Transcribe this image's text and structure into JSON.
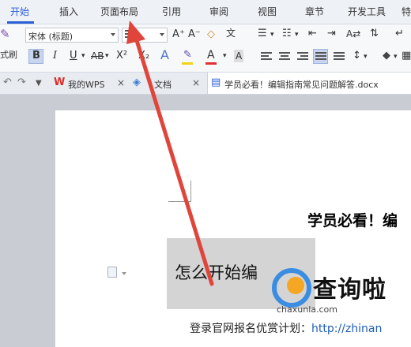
{
  "menu": {
    "tabs": [
      {
        "label": "开始",
        "active": true
      },
      {
        "label": "插入"
      },
      {
        "label": "页面布局"
      },
      {
        "label": "引用"
      },
      {
        "label": "审阅"
      },
      {
        "label": "视图"
      },
      {
        "label": "章节"
      },
      {
        "label": "开发工具"
      },
      {
        "label": "特"
      }
    ]
  },
  "ribbon": {
    "brush_label": "式刷",
    "font_name": "宋体 (标题)",
    "bold": "B",
    "italic": "I",
    "underline": "U",
    "strike": "AB",
    "superscript": "X²",
    "subscript": "X₂",
    "grow_font": "A⁺",
    "shrink_font": "A⁻",
    "text_effect": "A",
    "highlight": "✎",
    "font_color": "A",
    "char_shade": "A",
    "phonetic": "文"
  },
  "doc_tabs": [
    {
      "label": "我的WPS",
      "close": "×"
    },
    {
      "label": "文档",
      "close": "×"
    },
    {
      "label": "学员必看！编辑指南常见问题解答.docx",
      "close": "×",
      "active": true
    }
  ],
  "document": {
    "title": "学员必看！编",
    "heading": "怎么开始编",
    "body_prefix": "登录官网报名优赏计划：",
    "body_link": "http://zhinan"
  },
  "watermark": {
    "text": "查询啦",
    "url": "chaxunla.com"
  },
  "colors": {
    "accent": "#2a5fd8",
    "arrow": "#e0453b",
    "highlight_bar": "#f5d21a",
    "font_color_bar": "#e03030"
  }
}
